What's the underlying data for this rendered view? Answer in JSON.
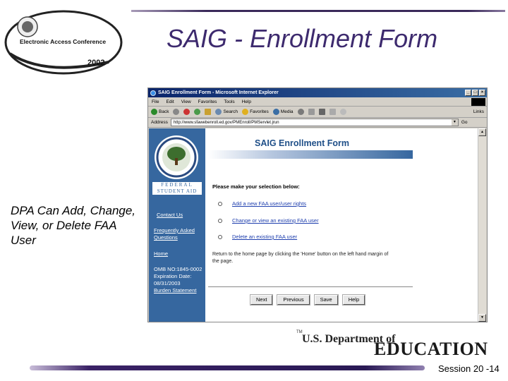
{
  "slide": {
    "title": "SAIG - Enrollment Form",
    "logo": {
      "line1": "Electronic Access Conference",
      "year": "2002"
    },
    "side_text": "DPA Can Add, Change, View, or Delete FAA User",
    "session": "Session 20 -14",
    "footer_logo": {
      "tm": "TM",
      "line1": "U.S. Department of",
      "line2": "EDUCATION"
    }
  },
  "browser": {
    "title": "SAIG Enrollment Form - Microsoft Internet Explorer",
    "menu": [
      "File",
      "Edit",
      "View",
      "Favorites",
      "Tools",
      "Help"
    ],
    "toolbar": {
      "back": "Back",
      "search": "Search",
      "favorites": "Favorites",
      "media": "Media",
      "links": "Links"
    },
    "address_label": "Address",
    "address": "http://www.sfawebenroll.ed.gov/PMEnroll/PMServlet.jrun",
    "go": "Go"
  },
  "page": {
    "fsa": {
      "line1": "FEDERAL",
      "line2": "STUDENT AID"
    },
    "nav": {
      "contact": "Contact Us",
      "faq": "Frequently Asked Questions",
      "home": "Home",
      "omb": "OMB NO:1845-0002 Expiration Date: 08/31/2003",
      "burden": "Burden Statement"
    },
    "form_title": "SAIG Enrollment Form",
    "prompt": "Please make your selection below:",
    "options": [
      "Add a new FAA user/user rights",
      "Change or view an existing FAA user",
      "Delete an existing FAA user"
    ],
    "note": "Return to the home page by clicking the 'Home' button on the left hand margin of the page.",
    "buttons": {
      "next": "Next",
      "previous": "Previous",
      "save": "Save",
      "help": "Help"
    }
  }
}
